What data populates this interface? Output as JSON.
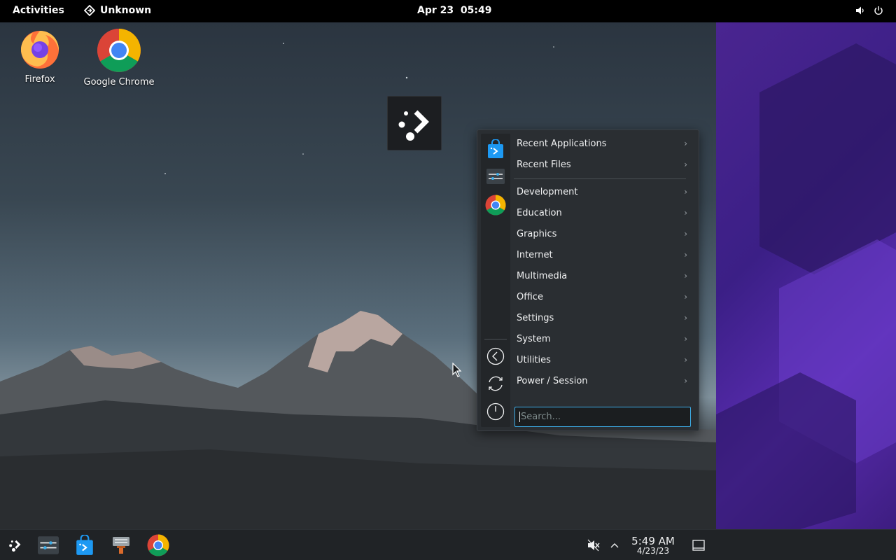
{
  "topbar": {
    "activities": "Activities",
    "app_name": "Unknown",
    "clock": "Apr 23  05:49"
  },
  "desktop": {
    "icons": [
      {
        "label": "Firefox",
        "icon": "firefox-icon"
      },
      {
        "label": "Google Chrome",
        "icon": "chrome-icon"
      }
    ]
  },
  "menu": {
    "favorites": [
      "discover-icon",
      "settings-sliders-icon",
      "chrome-icon"
    ],
    "actions": [
      "back-icon",
      "refresh-icon",
      "power-icon"
    ],
    "items": [
      {
        "label": "Recent Applications"
      },
      {
        "label": "Recent Files"
      },
      {
        "label": "Development"
      },
      {
        "label": "Education"
      },
      {
        "label": "Graphics"
      },
      {
        "label": "Internet"
      },
      {
        "label": "Multimedia"
      },
      {
        "label": "Office"
      },
      {
        "label": "Settings"
      },
      {
        "label": "System"
      },
      {
        "label": "Utilities"
      },
      {
        "label": "Power / Session"
      }
    ],
    "search_placeholder": "Search..."
  },
  "taskbar": {
    "apps": [
      "kde-launcher-icon",
      "system-settings-icon",
      "discover-icon",
      "package-manager-icon",
      "chrome-icon"
    ],
    "time": "5:49 AM",
    "date": "4/23/23"
  },
  "colors": {
    "accent": "#3daee9",
    "menu_bg": "#2a2e32",
    "taskbar_bg": "#202326"
  }
}
